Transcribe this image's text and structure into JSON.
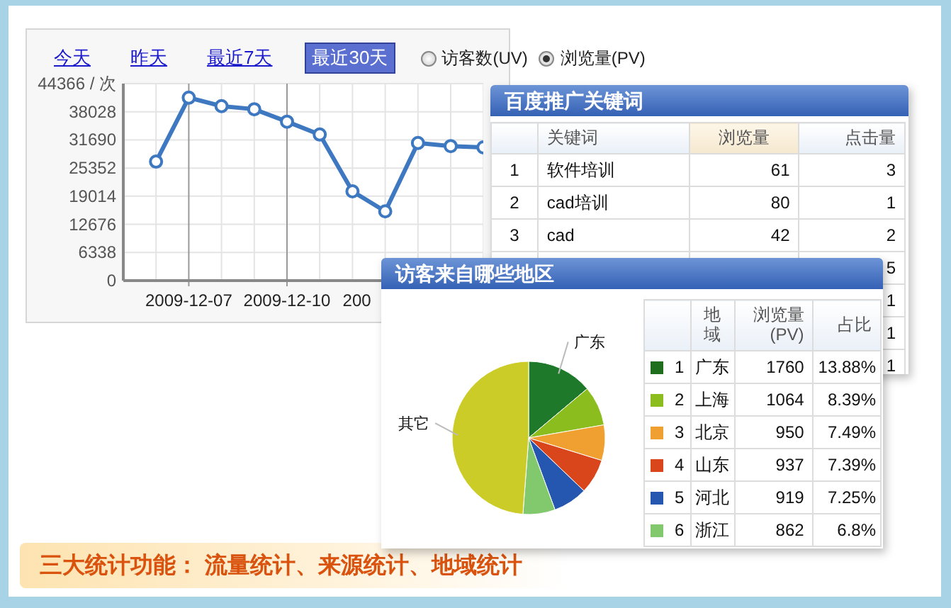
{
  "traffic_panel": {
    "ranges": [
      {
        "label": "今天",
        "selected": false
      },
      {
        "label": "昨天",
        "selected": false
      },
      {
        "label": "最近7天",
        "selected": false
      },
      {
        "label": "最近30天",
        "selected": true
      }
    ],
    "metrics": [
      {
        "label": "访客数(UV)",
        "selected": false
      },
      {
        "label": "浏览量(PV)",
        "selected": true
      }
    ],
    "chart_data": {
      "type": "line",
      "grid": true,
      "categories": [
        null,
        null,
        "2009-12-07",
        null,
        null,
        "2009-12-10",
        null,
        null,
        null,
        null,
        null,
        null
      ],
      "marker": "o",
      "ylim": [
        0,
        44366
      ],
      "yticks": [
        0,
        6338,
        12676,
        19014,
        25352,
        31690,
        38028,
        {
          "value": 44366,
          "label": "44366 / 次"
        }
      ],
      "values": [
        null,
        26800,
        41200,
        39300,
        38600,
        35800,
        32900,
        20100,
        15600,
        31000,
        30300,
        30000
      ]
    },
    "cut_axis_label": "200"
  },
  "keyword_panel": {
    "title": "百度推广关键词",
    "columns": [
      {
        "label": "关键词",
        "sorted": false
      },
      {
        "label": "浏览量",
        "sorted": true
      },
      {
        "label": "点击量",
        "sorted": false
      }
    ],
    "rows": [
      {
        "index": "1",
        "keyword": "软件培训",
        "views": "61",
        "clicks": "3"
      },
      {
        "index": "2",
        "keyword": "cad培训",
        "views": "80",
        "clicks": "1"
      },
      {
        "index": "3",
        "keyword": "cad",
        "views": "42",
        "clicks": "2"
      },
      {
        "clicks": "5"
      },
      {
        "clicks": "1"
      },
      {
        "clicks": "1"
      },
      {
        "clicks": "1"
      }
    ]
  },
  "region_panel": {
    "title": "访客来自哪些地区",
    "chart_data": {
      "type": "pie",
      "categories": [
        "广东",
        null,
        null,
        null,
        null,
        null,
        "其它"
      ],
      "colors": [
        "#1e7a2a",
        "#8cbd1e",
        "#f0a030",
        "#d9461c",
        "#2556b0",
        "#82c86c",
        "#cccc28"
      ],
      "values": [
        13.88,
        8.39,
        7.49,
        7.39,
        7.25,
        6.8,
        48.8
      ]
    },
    "columns": [
      "地域",
      "浏览量\n(PV)",
      "占比"
    ],
    "rows": [
      {
        "index": "1",
        "color": "#1e6e1e",
        "region": "广东",
        "pv": "1760",
        "share": "13.88%"
      },
      {
        "index": "2",
        "color": "#8cbd1e",
        "region": "上海",
        "pv": "1064",
        "share": "8.39%"
      },
      {
        "index": "3",
        "color": "#f0a030",
        "region": "北京",
        "pv": "950",
        "share": "7.49%"
      },
      {
        "index": "4",
        "color": "#d9461c",
        "region": "山东",
        "pv": "937",
        "share": "7.39%"
      },
      {
        "index": "5",
        "color": "#2556b0",
        "region": "河北",
        "pv": "919",
        "share": "7.25%"
      },
      {
        "index": "6",
        "color": "#82c86c",
        "region": "浙江",
        "pv": "862",
        "share": "6.8%"
      }
    ]
  },
  "banner": "三大统计功能： 流量统计、来源统计、地域统计"
}
